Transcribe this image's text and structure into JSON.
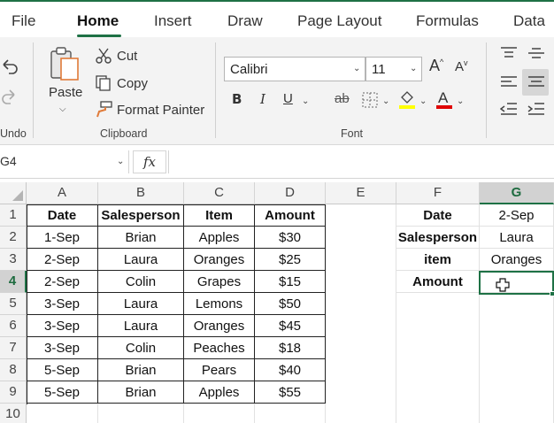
{
  "ribbon_tabs": [
    "File",
    "Home",
    "Insert",
    "Draw",
    "Page Layout",
    "Formulas",
    "Data"
  ],
  "active_tab": "Home",
  "undo_group": {
    "label": "Undo"
  },
  "clipboard": {
    "paste": "Paste",
    "cut": "Cut",
    "copy": "Copy",
    "format_painter": "Format Painter",
    "group_label": "Clipboard"
  },
  "font": {
    "family": "Calibri",
    "size": "11",
    "group_label": "Font",
    "bold": "B",
    "italic": "I",
    "underline": "U",
    "strike": "ab",
    "highlight_color": "#ffff00",
    "font_color": "#e00000"
  },
  "formula_bar": {
    "name_box": "G4",
    "fx": "fx",
    "value": ""
  },
  "columns": [
    "A",
    "B",
    "C",
    "D",
    "E",
    "F",
    "G"
  ],
  "selected_column": "G",
  "rows": [
    "1",
    "2",
    "3",
    "4",
    "5",
    "6",
    "7",
    "8",
    "9",
    "10"
  ],
  "selected_row": "4",
  "table": {
    "headers": [
      "Date",
      "Salesperson",
      "Item",
      "Amount"
    ],
    "data": [
      [
        "1-Sep",
        "Brian",
        "Apples",
        "$30"
      ],
      [
        "2-Sep",
        "Laura",
        "Oranges",
        "$25"
      ],
      [
        "2-Sep",
        "Colin",
        "Grapes",
        "$15"
      ],
      [
        "3-Sep",
        "Laura",
        "Lemons",
        "$50"
      ],
      [
        "3-Sep",
        "Laura",
        "Oranges",
        "$45"
      ],
      [
        "3-Sep",
        "Colin",
        "Peaches",
        "$18"
      ],
      [
        "5-Sep",
        "Brian",
        "Pears",
        "$40"
      ],
      [
        "5-Sep",
        "Brian",
        "Apples",
        "$55"
      ]
    ]
  },
  "lookup": {
    "labels": [
      "Date",
      "Salesperson",
      "item",
      "Amount"
    ],
    "values": [
      "2-Sep",
      "Laura",
      "Oranges",
      ""
    ]
  },
  "colors": {
    "accent": "#1e7145"
  }
}
